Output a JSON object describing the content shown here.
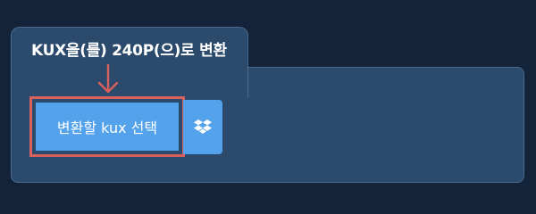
{
  "tab": {
    "title": "KUX을(를) 240P(으)로 변환"
  },
  "buttons": {
    "convert_label": "변환할 kux 선택",
    "dropbox_icon": "dropbox-icon"
  },
  "colors": {
    "background": "#13243a",
    "panel": "#2c4a6c",
    "button": "#55a2ec",
    "highlight": "#d9605c"
  }
}
